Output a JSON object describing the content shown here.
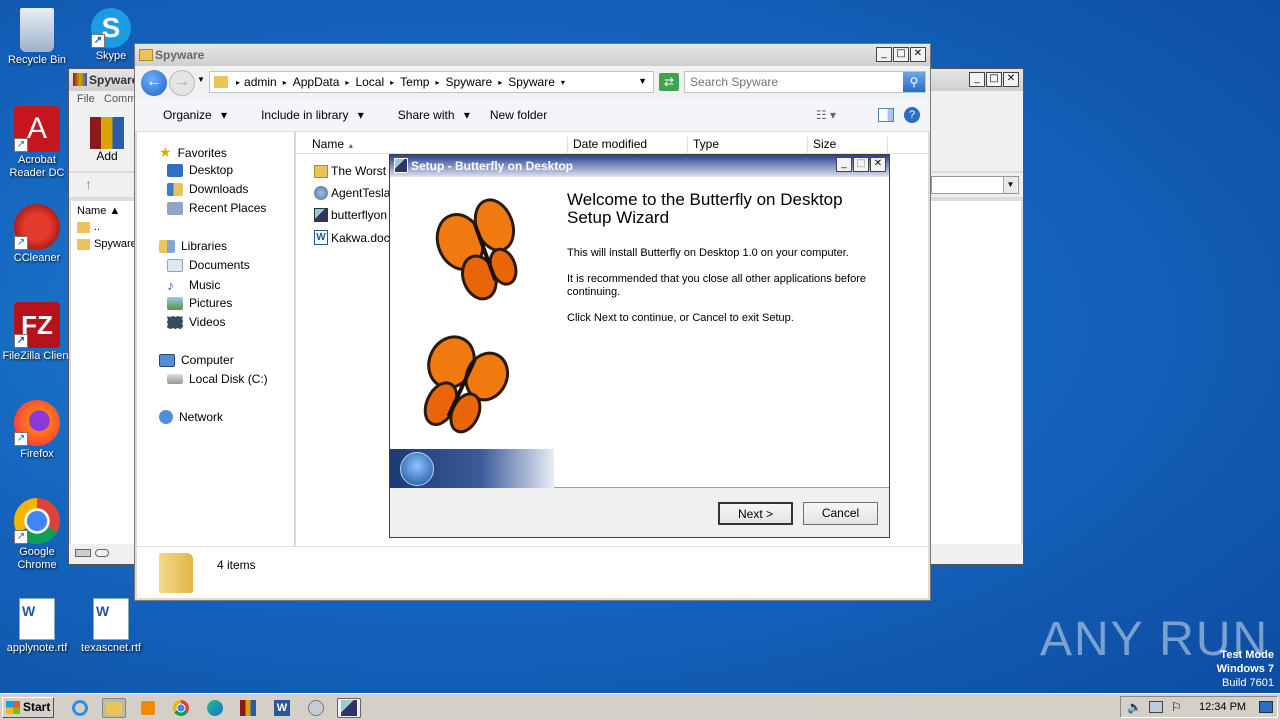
{
  "desktop": {
    "icons": [
      {
        "label": "Recycle Bin",
        "icon": "recycle-bin-icon"
      },
      {
        "label": "Skype",
        "icon": "skype-icon"
      },
      {
        "label": "Acrobat Reader DC",
        "icon": "acrobat-icon"
      },
      {
        "label": "CCleaner",
        "icon": "ccleaner-icon"
      },
      {
        "label": "FileZilla Client",
        "icon": "filezilla-icon"
      },
      {
        "label": "Firefox",
        "icon": "firefox-icon"
      },
      {
        "label": "Google Chrome",
        "icon": "chrome-icon"
      },
      {
        "label": "applynote.rtf",
        "icon": "word-doc-icon"
      },
      {
        "label": "texascnet.rtf",
        "icon": "word-doc-icon"
      }
    ],
    "watermark": "ANY RUN",
    "test_mode": {
      "line1": "Test Mode",
      "line2": "Windows 7",
      "line3": "Build 7601"
    }
  },
  "back_window": {
    "title": "Spyware",
    "menu_file": "File",
    "menu_comm": "Comm",
    "add_label": "Add",
    "name_col": "Name",
    "rows": [
      "..",
      "Spyware"
    ]
  },
  "explorer": {
    "title": "Spyware",
    "breadcrumb": [
      "admin",
      "AppData",
      "Local",
      "Temp",
      "Spyware",
      "Spyware"
    ],
    "search_placeholder": "Search Spyware",
    "toolbar": {
      "organize": "Organize",
      "include": "Include in library",
      "share": "Share with",
      "newfolder": "New folder"
    },
    "nav": {
      "favorites": "Favorites",
      "desktop": "Desktop",
      "downloads": "Downloads",
      "recent": "Recent Places",
      "libraries": "Libraries",
      "documents": "Documents",
      "music": "Music",
      "pictures": "Pictures",
      "videos": "Videos",
      "computer": "Computer",
      "localdisk": "Local Disk (C:)",
      "network": "Network"
    },
    "columns": {
      "name": "Name",
      "date": "Date modified",
      "type": "Type",
      "size": "Size"
    },
    "files": [
      "The Worst",
      "AgentTesla",
      "butterflyon",
      "Kakwa.doc"
    ],
    "item_count": "4 items"
  },
  "setup": {
    "title": "Setup - Butterfly on Desktop",
    "heading": "Welcome to the Butterfly on Desktop Setup Wizard",
    "p1": "This will install Butterfly on Desktop 1.0 on your computer.",
    "p2": "It is recommended that you close all other applications before continuing.",
    "p3": "Click Next to continue, or Cancel to exit Setup.",
    "next": "Next >",
    "cancel": "Cancel"
  },
  "taskbar": {
    "start": "Start",
    "clock": "12:34 PM"
  }
}
